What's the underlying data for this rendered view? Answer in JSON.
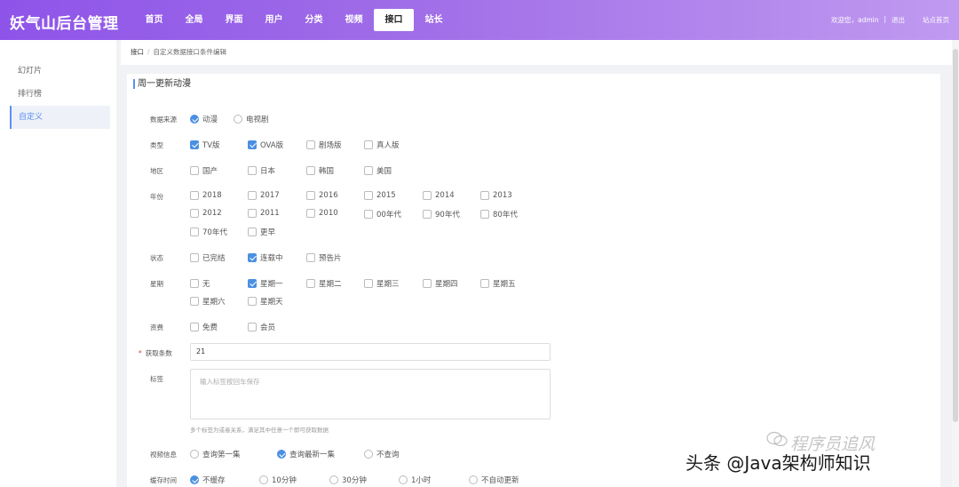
{
  "header": {
    "logo": "妖气山后台管理",
    "nav": [
      "首页",
      "全局",
      "界面",
      "用户",
      "分类",
      "视频",
      "接口",
      "站长"
    ],
    "active_nav": "接口",
    "welcome": "欢迎您，admin",
    "divider": "|",
    "logout": "退出",
    "site_home": "站点首页"
  },
  "sidebar": {
    "items": [
      "幻灯片",
      "排行榜",
      "自定义"
    ],
    "active": "自定义"
  },
  "breadcrumb": {
    "home": "接口",
    "sep": "/",
    "current": "自定义数据接口条件编辑"
  },
  "form": {
    "section_title": "周一更新动漫",
    "source": {
      "label": "数据来源",
      "options": [
        {
          "text": "动漫",
          "checked": true
        },
        {
          "text": "电视剧",
          "checked": false
        }
      ]
    },
    "type": {
      "label": "类型",
      "options": [
        {
          "text": "TV版",
          "checked": true
        },
        {
          "text": "OVA版",
          "checked": true
        },
        {
          "text": "剧场版",
          "checked": false
        },
        {
          "text": "真人版",
          "checked": false
        }
      ]
    },
    "region": {
      "label": "地区",
      "options": [
        {
          "text": "国产",
          "checked": false
        },
        {
          "text": "日本",
          "checked": false
        },
        {
          "text": "韩国",
          "checked": false
        },
        {
          "text": "美国",
          "checked": false
        }
      ]
    },
    "year": {
      "label": "年份",
      "options": [
        {
          "text": "2018",
          "checked": false
        },
        {
          "text": "2017",
          "checked": false
        },
        {
          "text": "2016",
          "checked": false
        },
        {
          "text": "2015",
          "checked": false
        },
        {
          "text": "2014",
          "checked": false
        },
        {
          "text": "2013",
          "checked": false
        },
        {
          "text": "2012",
          "checked": false
        },
        {
          "text": "2011",
          "checked": false
        },
        {
          "text": "2010",
          "checked": false
        },
        {
          "text": "00年代",
          "checked": false
        },
        {
          "text": "90年代",
          "checked": false
        },
        {
          "text": "80年代",
          "checked": false
        },
        {
          "text": "70年代",
          "checked": false
        },
        {
          "text": "更早",
          "checked": false
        }
      ]
    },
    "status": {
      "label": "状态",
      "options": [
        {
          "text": "已完结",
          "checked": false
        },
        {
          "text": "连载中",
          "checked": true
        },
        {
          "text": "预告片",
          "checked": false
        }
      ]
    },
    "weekday": {
      "label": "星期",
      "options": [
        {
          "text": "无",
          "checked": false
        },
        {
          "text": "星期一",
          "checked": true
        },
        {
          "text": "星期二",
          "checked": false
        },
        {
          "text": "星期三",
          "checked": false
        },
        {
          "text": "星期四",
          "checked": false
        },
        {
          "text": "星期五",
          "checked": false
        },
        {
          "text": "星期六",
          "checked": false
        },
        {
          "text": "星期天",
          "checked": false
        }
      ]
    },
    "fee": {
      "label": "资费",
      "options": [
        {
          "text": "免费",
          "checked": false
        },
        {
          "text": "会员",
          "checked": false
        }
      ]
    },
    "count": {
      "required_mark": "*",
      "label": "获取条数",
      "value": "21"
    },
    "tags": {
      "label": "标签",
      "placeholder": "输入标签按回车保存",
      "hint": "多个标签为或者关系，满足其中任意一个即可获取数据"
    },
    "video_info": {
      "label": "视频信息",
      "options": [
        {
          "text": "查询第一集",
          "checked": false
        },
        {
          "text": "查询最新一集",
          "checked": true
        },
        {
          "text": "不查询",
          "checked": false
        }
      ]
    },
    "cache_time": {
      "label": "缓存时间",
      "options": [
        {
          "text": "不缓存",
          "checked": true
        },
        {
          "text": "10分钟",
          "checked": false
        },
        {
          "text": "30分钟",
          "checked": false
        },
        {
          "text": "1小时",
          "checked": false
        },
        {
          "text": "不自动更新",
          "checked": false
        }
      ]
    }
  },
  "watermark": {
    "main": "头条 @Java架构师知识",
    "faint": "程序员追风"
  }
}
